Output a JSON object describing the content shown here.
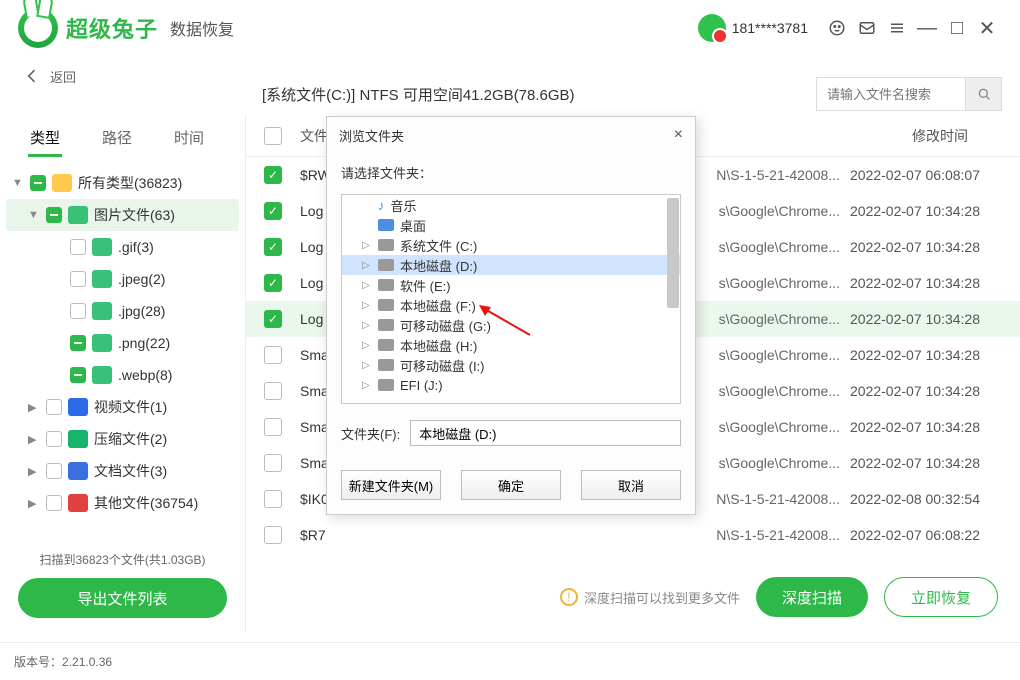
{
  "app": {
    "title": "超级兔子",
    "subtitle": "数据恢复",
    "phone": "181****3781"
  },
  "back_label": "返回",
  "path_text": "[系统文件(C:)] NTFS 可用空间41.2GB(78.6GB)",
  "search_placeholder": "请输入文件名搜索",
  "tabs": {
    "t1": "类型",
    "t2": "路径",
    "t3": "时间"
  },
  "tree": {
    "all": "所有类型(36823)",
    "img": "图片文件(63)",
    "gif": ".gif(3)",
    "jpeg": ".jpeg(2)",
    "jpg": ".jpg(28)",
    "png": ".png(22)",
    "webp": ".webp(8)",
    "video": "视频文件(1)",
    "arc": "压缩文件(2)",
    "doc": "文档文件(3)",
    "other": "其他文件(36754)"
  },
  "scan_info": "扫描到36823个文件(共1.03GB)",
  "export_label": "导出文件列表",
  "cols": {
    "name": "文件",
    "time": "修改时间"
  },
  "rows": [
    {
      "checked": true,
      "name": "$RW",
      "path": "N\\S-1-5-21-42008...",
      "time": "2022-02-07 06:08:07"
    },
    {
      "checked": true,
      "name": "Log",
      "path": "s\\Google\\Chrome...",
      "time": "2022-02-07 10:34:28"
    },
    {
      "checked": true,
      "name": "Log",
      "path": "s\\Google\\Chrome...",
      "time": "2022-02-07 10:34:28"
    },
    {
      "checked": true,
      "name": "Log",
      "path": "s\\Google\\Chrome...",
      "time": "2022-02-07 10:34:28"
    },
    {
      "checked": true,
      "name": "Log",
      "path": "s\\Google\\Chrome...",
      "time": "2022-02-07 10:34:28",
      "sel": true
    },
    {
      "checked": false,
      "name": "Sma",
      "path": "s\\Google\\Chrome...",
      "time": "2022-02-07 10:34:28"
    },
    {
      "checked": false,
      "name": "Sma",
      "path": "s\\Google\\Chrome...",
      "time": "2022-02-07 10:34:28"
    },
    {
      "checked": false,
      "name": "Sma",
      "path": "s\\Google\\Chrome...",
      "time": "2022-02-07 10:34:28"
    },
    {
      "checked": false,
      "name": "Sma",
      "path": "s\\Google\\Chrome...",
      "time": "2022-02-07 10:34:28"
    },
    {
      "checked": false,
      "name": "$IK0",
      "path": "N\\S-1-5-21-42008...",
      "time": "2022-02-08 00:32:54"
    },
    {
      "checked": false,
      "name": "$R7",
      "path": "N\\S-1-5-21-42008...",
      "time": "2022-02-07 06:08:22"
    }
  ],
  "tip_text": "深度扫描可以找到更多文件",
  "deep_scan": "深度扫描",
  "recover": "立即恢复",
  "version_label": "版本号：",
  "version": "2.21.0.36",
  "dialog": {
    "title": "浏览文件夹",
    "choose_label": "请选择文件夹：",
    "nodes": [
      {
        "label": "音乐",
        "icon": "music"
      },
      {
        "label": "桌面",
        "icon": "blue"
      },
      {
        "label": "系统文件 (C:)",
        "icon": "drive",
        "expandable": true
      },
      {
        "label": "本地磁盘 (D:)",
        "icon": "drive",
        "expandable": true,
        "selected": true
      },
      {
        "label": "软件 (E:)",
        "icon": "drive",
        "expandable": true
      },
      {
        "label": "本地磁盘 (F:)",
        "icon": "drive",
        "expandable": true
      },
      {
        "label": "可移动磁盘 (G:)",
        "icon": "drive",
        "expandable": true
      },
      {
        "label": "本地磁盘 (H:)",
        "icon": "drive",
        "expandable": true
      },
      {
        "label": "可移动磁盘 (I:)",
        "icon": "drive",
        "expandable": true
      },
      {
        "label": "EFI (J:)",
        "icon": "drive",
        "expandable": true
      }
    ],
    "field_label": "文件夹(F):",
    "field_value": "本地磁盘 (D:)",
    "new_folder": "新建文件夹(M)",
    "ok": "确定",
    "cancel": "取消"
  }
}
